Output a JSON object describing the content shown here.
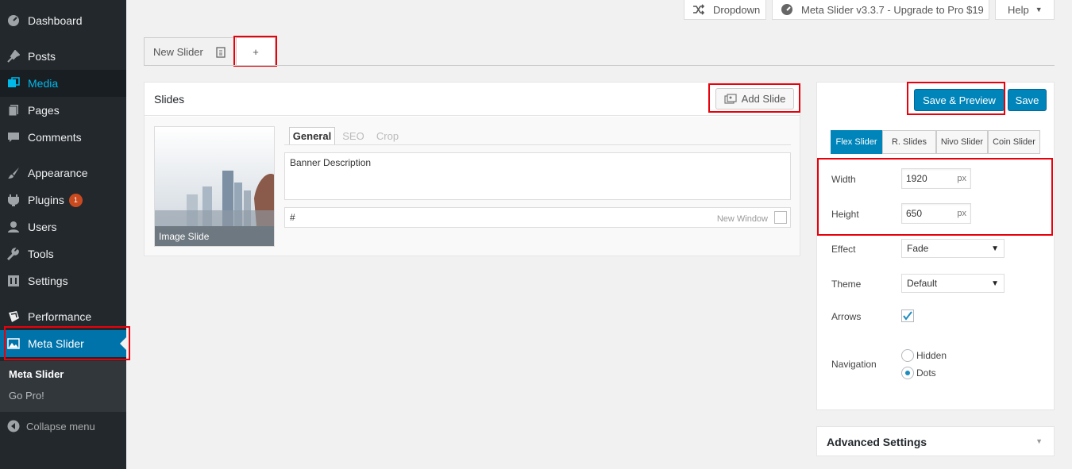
{
  "sidebar": {
    "items": [
      {
        "label": "Dashboard",
        "icon": "dashboard-icon"
      },
      {
        "label": "Posts",
        "icon": "pin-icon"
      },
      {
        "label": "Media",
        "icon": "media-icon"
      },
      {
        "label": "Pages",
        "icon": "pages-icon"
      },
      {
        "label": "Comments",
        "icon": "comments-icon"
      },
      {
        "label": "Appearance",
        "icon": "brush-icon"
      },
      {
        "label": "Plugins",
        "icon": "plugin-icon",
        "badge": "1"
      },
      {
        "label": "Users",
        "icon": "users-icon"
      },
      {
        "label": "Tools",
        "icon": "wrench-icon"
      },
      {
        "label": "Settings",
        "icon": "settings-icon"
      },
      {
        "label": "Performance",
        "icon": "performance-icon"
      },
      {
        "label": "Meta Slider",
        "icon": "meta-slider-icon"
      }
    ],
    "submenu": [
      "Meta Slider",
      "Go Pro!"
    ],
    "collapse_label": "Collapse menu"
  },
  "topbar": {
    "dropdown_label": "Dropdown",
    "upgrade_label": "Meta Slider v3.3.7 - Upgrade to Pro $19",
    "help_label": "Help"
  },
  "tabs": {
    "slider_name": "New Slider",
    "add_label": "+"
  },
  "slides": {
    "title": "Slides",
    "add_slide_label": "Add Slide",
    "thumb_caption": "Image Slide",
    "subtabs": [
      "General",
      "SEO",
      "Crop"
    ],
    "description": "Banner Description",
    "url_value": "#",
    "new_window_label": "New Window"
  },
  "settings": {
    "save_preview_label": "Save & Preview",
    "save_label": "Save",
    "slider_types": [
      "Flex Slider",
      "R. Slides",
      "Nivo Slider",
      "Coin Slider"
    ],
    "width_label": "Width",
    "width_value": "1920",
    "height_label": "Height",
    "height_value": "650",
    "unit": "px",
    "effect_label": "Effect",
    "effect_value": "Fade",
    "theme_label": "Theme",
    "theme_value": "Default",
    "arrows_label": "Arrows",
    "navigation_label": "Navigation",
    "nav_options": [
      "Hidden",
      "Dots"
    ]
  },
  "advanced_label": "Advanced Settings",
  "colors": {
    "accent": "#0085ba",
    "highlight": "#e8000b",
    "sidebar": "#23282d"
  }
}
